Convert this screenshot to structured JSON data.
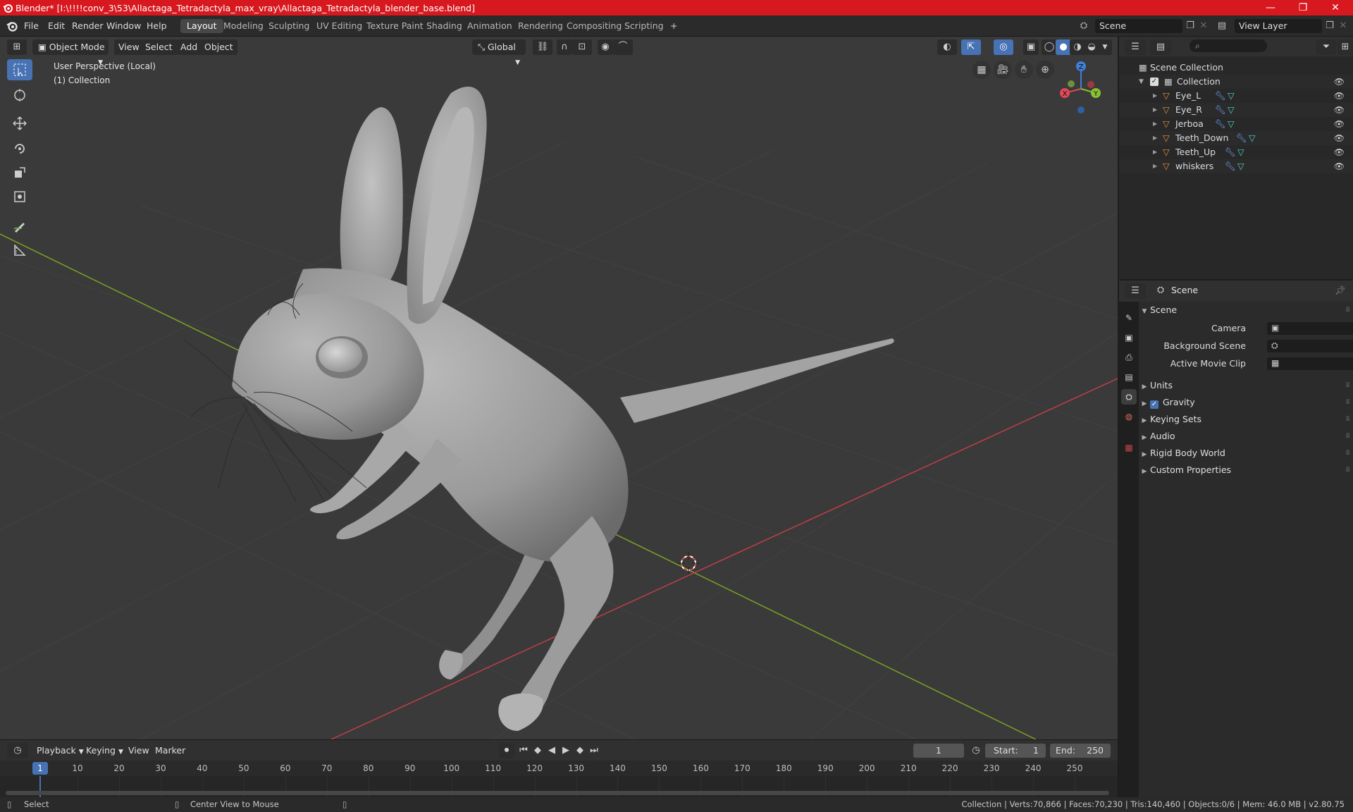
{
  "window": {
    "title": "Blender* [I:\\!!!!conv_3\\53\\Allactaga_Tetradactyla_max_vray\\Allactaga_Tetradactyla_blender_base.blend]",
    "controls": [
      "minimize",
      "maximize",
      "close"
    ]
  },
  "menubar": {
    "items": [
      "File",
      "Edit",
      "Render",
      "Window",
      "Help"
    ],
    "workspaces": [
      "Layout",
      "Modeling",
      "Sculpting",
      "UV Editing",
      "Texture Paint",
      "Shading",
      "Animation",
      "Rendering",
      "Compositing",
      "Scripting"
    ],
    "active_workspace": "Layout",
    "add_workspace": "+",
    "scene": "Scene",
    "view_layer": "View Layer"
  },
  "viewport": {
    "mode": "Object Mode",
    "menus": [
      "View",
      "Select",
      "Add",
      "Object"
    ],
    "transform_orientation": "Global",
    "info_line1": "User Perspective (Local)",
    "info_line2": "(1) Collection",
    "gizmo": {
      "x": "X",
      "y": "Y",
      "z": "Z"
    },
    "colors": {
      "background": "#3a3a3a",
      "x_axis": "#cf3f48",
      "y_axis": "#87b41f",
      "accent": "#4772b3"
    }
  },
  "outliner": {
    "root": "Scene Collection",
    "collection": "Collection",
    "objects": [
      {
        "name": "Eye_L"
      },
      {
        "name": "Eye_R"
      },
      {
        "name": "Jerboa"
      },
      {
        "name": "Teeth_Down"
      },
      {
        "name": "Teeth_Up"
      },
      {
        "name": "whiskers"
      }
    ]
  },
  "properties": {
    "context": "Scene",
    "section": "Scene",
    "fields": [
      {
        "label": "Camera"
      },
      {
        "label": "Background Scene"
      },
      {
        "label": "Active Movie Clip"
      }
    ],
    "panels": [
      {
        "label": "Units",
        "checkbox": false
      },
      {
        "label": "Gravity",
        "checkbox": true
      },
      {
        "label": "Keying Sets",
        "checkbox": false
      },
      {
        "label": "Audio",
        "checkbox": false
      },
      {
        "label": "Rigid Body World",
        "checkbox": false
      },
      {
        "label": "Custom Properties",
        "checkbox": false
      }
    ]
  },
  "timeline": {
    "menus": [
      "Playback",
      "Keying",
      "View",
      "Marker"
    ],
    "current_frame": "1",
    "start_label": "Start:",
    "start": "1",
    "end_label": "End:",
    "end": "250",
    "ticks": [
      "1",
      "10",
      "20",
      "30",
      "40",
      "50",
      "60",
      "70",
      "80",
      "90",
      "100",
      "110",
      "120",
      "130",
      "140",
      "150",
      "160",
      "170",
      "180",
      "190",
      "200",
      "210",
      "220",
      "230",
      "240",
      "250"
    ],
    "playhead_frame": 1
  },
  "statusbar": {
    "left": "Select",
    "middle": "Center View to Mouse",
    "right": "Collection | Verts:70,866 | Faces:70,230 | Tris:140,460 | Objects:0/6 | Mem: 46.0 MB | v2.80.75"
  }
}
